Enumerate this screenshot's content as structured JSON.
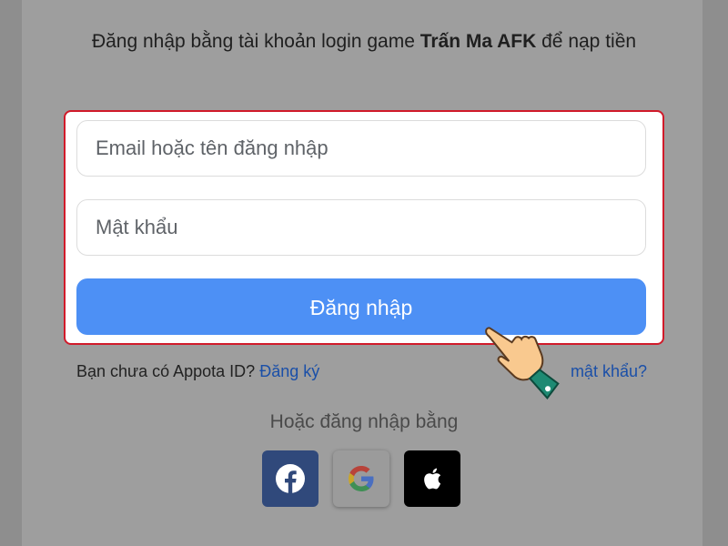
{
  "heading": {
    "prefix": "Đăng nhập bằng tài khoản login game ",
    "game_name": "Trấn Ma AFK",
    "suffix": " để nạp tiền"
  },
  "form": {
    "email_placeholder": "Email hoặc tên đăng nhập",
    "password_placeholder": "Mật khẩu",
    "login_label": "Đăng nhập",
    "highlight_color": "#d11a2a",
    "button_color": "#4d90f5"
  },
  "signup": {
    "prompt": "Bạn chưa có Appota ID?",
    "link": "Đăng ký"
  },
  "forgot": {
    "label": "mật khẩu?"
  },
  "social": {
    "heading": "Hoặc đăng nhập bằng",
    "providers": [
      {
        "name": "facebook",
        "icon": "facebook-icon",
        "color": "#30497b"
      },
      {
        "name": "google",
        "icon": "google-icon",
        "color": "#9b9b9b"
      },
      {
        "name": "apple",
        "icon": "apple-icon",
        "color": "#000000"
      }
    ]
  },
  "overlay": {
    "icon": "pointing-hand-icon"
  }
}
